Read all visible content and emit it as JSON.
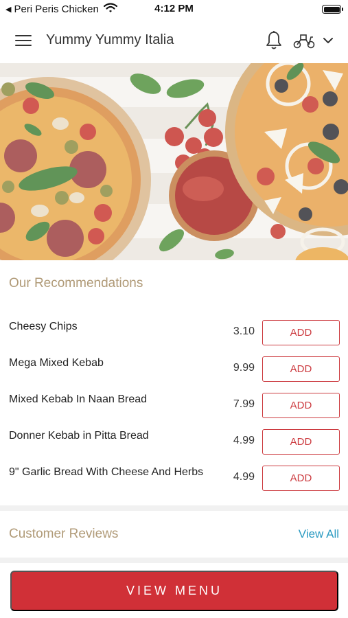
{
  "status_bar": {
    "back_app": "Peri Peris Chicken",
    "time": "4:12 PM"
  },
  "header": {
    "title": "Yummy Yummy Italia",
    "icons": [
      "hamburger-menu-icon",
      "bell-icon",
      "scooter-icon",
      "chevron-down-icon"
    ]
  },
  "recommendations": {
    "title": "Our Recommendations",
    "items": [
      {
        "name": "Cheesy Chips",
        "price": "3.10",
        "add_label": "ADD"
      },
      {
        "name": "Mega Mixed Kebab",
        "price": "9.99",
        "add_label": "ADD"
      },
      {
        "name": "Mixed Kebab In Naan Bread",
        "price": "7.99",
        "add_label": "ADD"
      },
      {
        "name": "Donner Kebab in Pitta Bread",
        "price": "4.99",
        "add_label": "ADD"
      },
      {
        "name": "9\" Garlic Bread With Cheese And Herbs",
        "price": "4.99",
        "add_label": "ADD"
      }
    ]
  },
  "reviews": {
    "title": "Customer Reviews",
    "view_all": "View All"
  },
  "footer": {
    "view_menu": "VIEW MENU"
  },
  "colors": {
    "accent_red": "#d03037",
    "section_gold": "#b09a77",
    "link_blue": "#2a9ac1"
  }
}
